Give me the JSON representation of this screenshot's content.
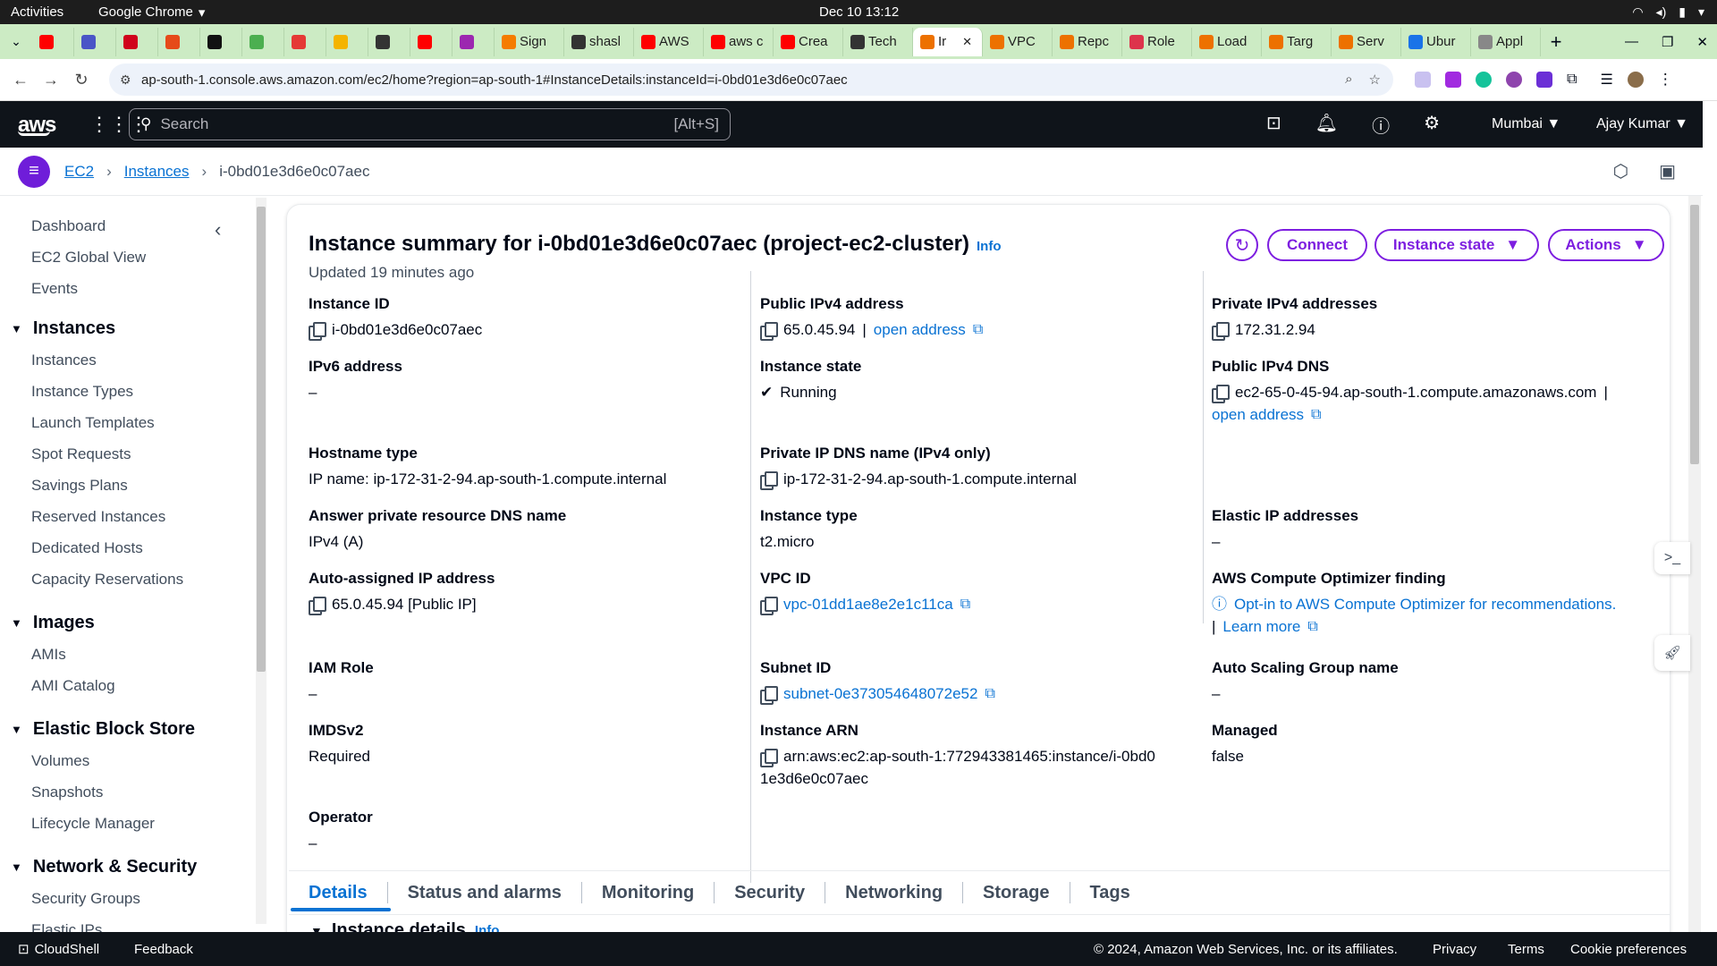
{
  "os": {
    "activities": "Activities",
    "app_name": "Google Chrome",
    "clock": "Dec 10  13:12"
  },
  "tabs": [
    {
      "label": "",
      "color": "#ff0000"
    },
    {
      "label": "",
      "color": "#4a55c7"
    },
    {
      "label": "",
      "color": "#d0021b"
    },
    {
      "label": "",
      "color": "#e64a19"
    },
    {
      "label": "",
      "color": "#111111"
    },
    {
      "label": "",
      "color": "#4caf50"
    },
    {
      "label": "",
      "color": "#e53935"
    },
    {
      "label": "",
      "color": "#f4b400"
    },
    {
      "label": "",
      "color": "#333333"
    },
    {
      "label": "",
      "color": "#ff0000"
    },
    {
      "label": "",
      "color": "#9c27b0"
    },
    {
      "label": "Sign",
      "color": "#f57c00"
    },
    {
      "label": "shasl",
      "color": "#333333"
    },
    {
      "label": "AWS",
      "color": "#ff0000"
    },
    {
      "label": "aws c",
      "color": "#ff0000"
    },
    {
      "label": "Crea",
      "color": "#ff0000"
    },
    {
      "label": "Tech",
      "color": "#333333"
    },
    {
      "label": "Ir",
      "color": "#ed7100",
      "active": true
    },
    {
      "label": "VPC",
      "color": "#ed7100"
    },
    {
      "label": "Repc",
      "color": "#ed7100"
    },
    {
      "label": "Role",
      "color": "#dd344c"
    },
    {
      "label": "Load",
      "color": "#ed7100"
    },
    {
      "label": "Targ",
      "color": "#ed7100"
    },
    {
      "label": "Serv",
      "color": "#ed7100"
    },
    {
      "label": "Ubur",
      "color": "#1a73e8"
    },
    {
      "label": "Appl",
      "color": "#888888"
    }
  ],
  "browser": {
    "url": "ap-south-1.console.aws.amazon.com/ec2/home?region=ap-south-1#InstanceDetails:instanceId=i-0bd01e3d6e0c07aec",
    "new_tab": "+"
  },
  "aws_header": {
    "logo": "aws",
    "search_placeholder": "Search",
    "search_shortcut": "[Alt+S]",
    "region": "Mumbai",
    "user": "Ajay Kumar"
  },
  "breadcrumb": {
    "service": "EC2",
    "section": "Instances",
    "current": "i-0bd01e3d6e0c07aec"
  },
  "sidebar": {
    "top_items": [
      "Dashboard",
      "EC2 Global View",
      "Events"
    ],
    "groups": [
      {
        "title": "Instances",
        "items": [
          "Instances",
          "Instance Types",
          "Launch Templates",
          "Spot Requests",
          "Savings Plans",
          "Reserved Instances",
          "Dedicated Hosts",
          "Capacity Reservations"
        ]
      },
      {
        "title": "Images",
        "items": [
          "AMIs",
          "AMI Catalog"
        ]
      },
      {
        "title": "Elastic Block Store",
        "items": [
          "Volumes",
          "Snapshots",
          "Lifecycle Manager"
        ]
      },
      {
        "title": "Network & Security",
        "items": [
          "Security Groups",
          "Elastic IPs"
        ]
      }
    ]
  },
  "summary": {
    "title": "Instance summary for i-0bd01e3d6e0c07aec (project-ec2-cluster)",
    "info": "Info",
    "updated": "Updated 19 minutes ago",
    "buttons": {
      "connect": "Connect",
      "instance_state": "Instance state",
      "actions": "Actions"
    },
    "col1": {
      "instance_id_label": "Instance ID",
      "instance_id": "i-0bd01e3d6e0c07aec",
      "ipv6_label": "IPv6 address",
      "ipv6": "–",
      "hostname_label": "Hostname type",
      "hostname": "IP name: ip-172-31-2-94.ap-south-1.compute.internal",
      "answer_label": "Answer private resource DNS name",
      "answer": "IPv4 (A)",
      "auto_ip_label": "Auto-assigned IP address",
      "auto_ip": "65.0.45.94 [Public IP]",
      "iam_label": "IAM Role",
      "iam": "–",
      "imds_label": "IMDSv2",
      "imds": "Required",
      "operator_label": "Operator",
      "operator": "–"
    },
    "col2": {
      "public_ipv4_label": "Public IPv4 address",
      "public_ipv4": "65.0.45.94",
      "open_address": "open address",
      "state_label": "Instance state",
      "state": "Running",
      "private_dns_label": "Private IP DNS name (IPv4 only)",
      "private_dns": "ip-172-31-2-94.ap-south-1.compute.internal",
      "type_label": "Instance type",
      "type": "t2.micro",
      "vpc_label": "VPC ID",
      "vpc": "vpc-01dd1ae8e2e1c11ca",
      "subnet_label": "Subnet ID",
      "subnet": "subnet-0e373054648072e52",
      "arn_label": "Instance ARN",
      "arn_line1": "arn:aws:ec2:ap-south-1:772943381465:instance/i-0bd0",
      "arn_line2": "1e3d6e0c07aec"
    },
    "col3": {
      "private_ipv4_label": "Private IPv4 addresses",
      "private_ipv4": "172.31.2.94",
      "public_dns_label": "Public IPv4 DNS",
      "public_dns": "ec2-65-0-45-94.ap-south-1.compute.amazonaws.com",
      "open_address": "open address",
      "eip_label": "Elastic IP addresses",
      "eip": "–",
      "optimizer_label": "AWS Compute Optimizer finding",
      "optimizer": "Opt-in to AWS Compute Optimizer for recommendations.",
      "learn_more": "Learn more",
      "asg_label": "Auto Scaling Group name",
      "asg": "–",
      "managed_label": "Managed",
      "managed": "false"
    }
  },
  "detail_tabs": [
    "Details",
    "Status and alarms",
    "Monitoring",
    "Security",
    "Networking",
    "Storage",
    "Tags"
  ],
  "section": {
    "title": "Instance details",
    "info": "Info"
  },
  "footer": {
    "cloudshell": "CloudShell",
    "feedback": "Feedback",
    "copyright": "© 2024, Amazon Web Services, Inc. or its affiliates.",
    "privacy": "Privacy",
    "terms": "Terms",
    "cookies": "Cookie preferences"
  },
  "colors": {
    "accent": "#7d1ee0",
    "link": "#0972d3",
    "running": "#037f0c",
    "header": "#0f141a"
  }
}
